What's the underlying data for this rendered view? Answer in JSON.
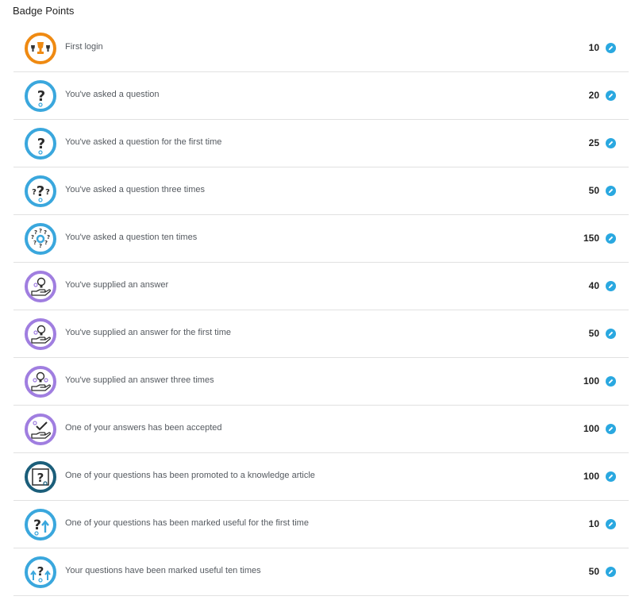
{
  "header": {
    "title": "Badge Points"
  },
  "colors": {
    "blue": "#3aa7dd",
    "purple": "#a07ee0",
    "orange": "#ef8a12",
    "teal": "#1b5e7a",
    "edit": "#2aa8e0"
  },
  "badges": [
    {
      "label": "First login",
      "points": "10",
      "ring": "#ef8a12",
      "icon": "trophy-icon"
    },
    {
      "label": "You've asked a question",
      "points": "20",
      "ring": "#3aa7dd",
      "icon": "question-icon"
    },
    {
      "label": "You've asked a question for the first time",
      "points": "25",
      "ring": "#3aa7dd",
      "icon": "question-icon"
    },
    {
      "label": "You've asked a question three times",
      "points": "50",
      "ring": "#3aa7dd",
      "icon": "questions-icon"
    },
    {
      "label": "You've asked a question ten times",
      "points": "150",
      "ring": "#3aa7dd",
      "icon": "question-ring-icon"
    },
    {
      "label": "You've supplied an answer",
      "points": "40",
      "ring": "#a07ee0",
      "icon": "hand-bulb-icon"
    },
    {
      "label": "You've supplied an answer for the first time",
      "points": "50",
      "ring": "#a07ee0",
      "icon": "hand-bulb-icon"
    },
    {
      "label": "You've supplied an answer three times",
      "points": "100",
      "ring": "#a07ee0",
      "icon": "hand-bulbs-icon"
    },
    {
      "label": "One of your answers has been accepted",
      "points": "100",
      "ring": "#a07ee0",
      "icon": "hand-check-icon"
    },
    {
      "label": "One of your questions has been promoted to a knowledge article",
      "points": "100",
      "ring": "#1b5e7a",
      "icon": "article-question-icon"
    },
    {
      "label": "One of your questions has been marked useful for the first time",
      "points": "10",
      "ring": "#3aa7dd",
      "icon": "question-up-icon"
    },
    {
      "label": "Your questions have been marked useful ten times",
      "points": "50",
      "ring": "#3aa7dd",
      "icon": "question-ups-icon"
    }
  ]
}
